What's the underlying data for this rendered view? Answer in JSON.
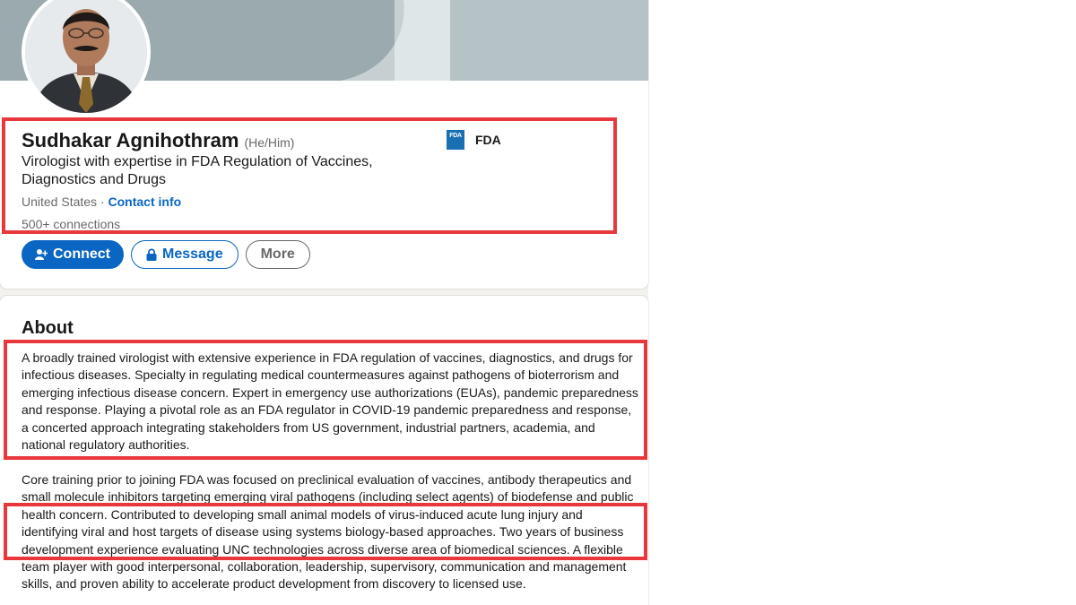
{
  "profile": {
    "name": "Sudhakar Agnihothram",
    "pronouns": "(He/Him)",
    "headline": "Virologist with expertise in FDA Regulation of Vaccines, Diagnostics and Drugs",
    "location": "United States",
    "separator": " · ",
    "contact_link": "Contact info",
    "connections": "500+ connections",
    "company": {
      "logo_text": "FDA",
      "name": "FDA"
    }
  },
  "actions": {
    "connect": "Connect",
    "message": "Message",
    "more": "More"
  },
  "about": {
    "title": "About",
    "paragraph1": "A broadly trained virologist with extensive experience in FDA regulation of vaccines, diagnostics, and drugs for infectious diseases. Specialty in regulating medical countermeasures against pathogens of bioterrorism and emerging infectious disease concern. Expert in emergency use authorizations (EUAs), pandemic preparedness and response. Playing a pivotal role as an FDA regulator in COVID-19 pandemic preparedness and response, a concerted approach integrating stakeholders from US government, industrial partners, academia, and national regulatory authorities.",
    "paragraph2": "Core training prior to joining FDA was focused on preclinical evaluation of vaccines, antibody therapeutics and small molecule inhibitors targeting emerging viral pathogens (including select agents) of biodefense and public health concern. Contributed to developing small animal models of virus-induced acute lung injury and identifying viral and host targets of disease using systems biology-based approaches. Two years of business development experience evaluating UNC technologies across diverse area of biomedical sciences. A flexible team player with good interpersonal, collaboration, leadership, supervisory, communication and management skills, and proven ability to accelerate product development from discovery to licensed use."
  },
  "colors": {
    "brand_blue": "#0a66c2",
    "highlight_red": "#e8383b",
    "fda_logo_blue": "#1a6fb3"
  },
  "icons": [
    "add-person-icon",
    "lock-icon",
    "fda-logo"
  ]
}
